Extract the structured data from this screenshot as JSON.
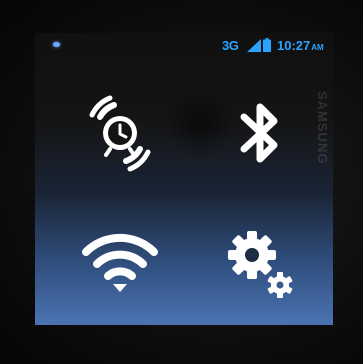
{
  "status_bar": {
    "network_type": "3G",
    "time": "10:27",
    "ampm": "AM",
    "accent_color": "#2aa4ff"
  },
  "reflection_text": "SAMSUNG",
  "quick_settings": [
    {
      "name": "alarm",
      "icon": "alarm-clock-ringing-icon"
    },
    {
      "name": "bluetooth",
      "icon": "bluetooth-icon"
    },
    {
      "name": "wifi",
      "icon": "wifi-icon"
    },
    {
      "name": "settings",
      "icon": "gears-icon"
    }
  ],
  "colors": {
    "icon": "#ffffff",
    "background_top": "#101010",
    "background_bottom": "#4b73b3"
  }
}
